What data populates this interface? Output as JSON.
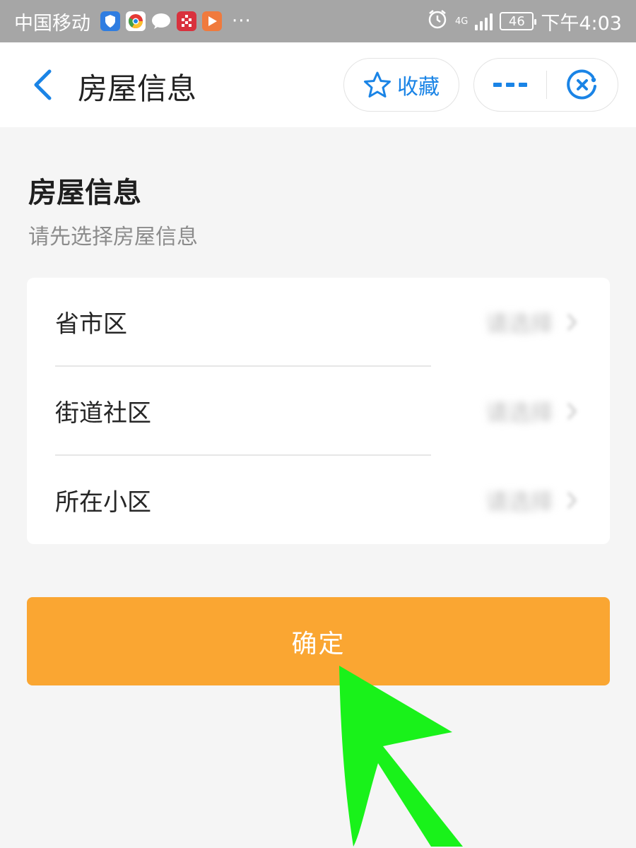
{
  "status_bar": {
    "carrier": "中国移动",
    "more": "···",
    "network": "4G",
    "battery": "46",
    "time": "下午4:03"
  },
  "header": {
    "title": "房屋信息",
    "favorite_label": "收藏"
  },
  "section": {
    "title": "房屋信息",
    "subtitle": "请先选择房屋信息"
  },
  "rows": [
    {
      "label": "省市区",
      "value": "请选择"
    },
    {
      "label": "街道社区",
      "value": "请选择"
    },
    {
      "label": "所在小区",
      "value": "请选择"
    }
  ],
  "confirm_label": "确定",
  "colors": {
    "accent_blue": "#1a84e6",
    "button_orange": "#faa632",
    "annotation_green": "#19f21a"
  }
}
